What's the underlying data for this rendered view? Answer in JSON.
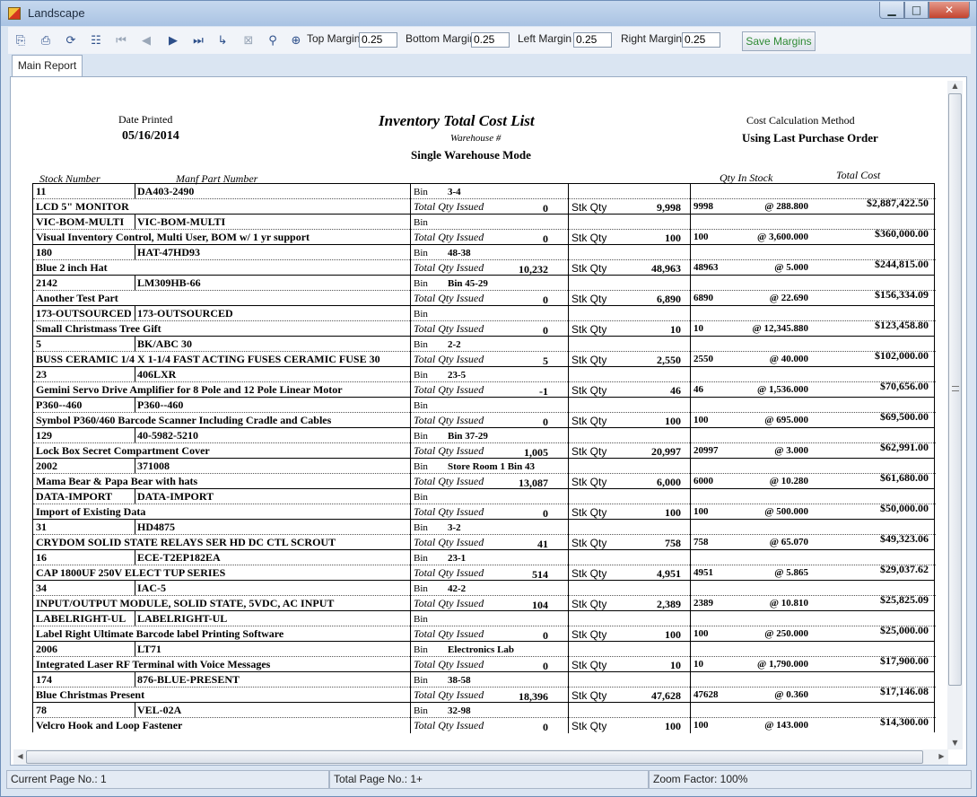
{
  "window": {
    "title": "Landscape"
  },
  "toolbar": {
    "icons": [
      "export-icon",
      "print-icon",
      "refresh-icon",
      "tree-icon",
      "first-page-icon",
      "prev-page-icon",
      "next-page-icon",
      "last-page-icon",
      "goto-page-icon",
      "stop-icon",
      "find-icon",
      "zoom-icon"
    ],
    "top_margin_label": "Top Margin",
    "top_margin": "0.25",
    "bottom_margin_label": "Bottom Margin",
    "bottom_margin": "0.25",
    "left_margin_label": "Left Margin",
    "left_margin": "0.25",
    "right_margin_label": "Right Margin",
    "right_margin": "0.25",
    "save_label": "Save Margins"
  },
  "tab": {
    "label": "Main Report"
  },
  "report": {
    "date_label": "Date Printed",
    "date": "05/16/2014",
    "title": "Inventory Total Cost List",
    "warehouse_label": "Warehouse #",
    "mode": "Single Warehouse Mode",
    "calc_label": "Cost Calculation Method",
    "calc_value": "Using Last Purchase Order",
    "col_stock": "Stock Number",
    "col_manf": "Manf Part Number",
    "col_qty": "Qty In Stock",
    "col_cost": "Total Cost",
    "bin_label": "Bin",
    "issued_label": "Total Qty Issued",
    "stk_label": "Stk Qty",
    "rows": [
      {
        "stock": "11",
        "manf": "DA403-2490",
        "bin": "3-4",
        "desc": "LCD 5\" MONITOR",
        "issued": "0",
        "stk": "9,998",
        "qty": "9998",
        "price": "@ 288.800",
        "total": "$2,887,422.50"
      },
      {
        "stock": "VIC-BOM-MULTI",
        "manf": "VIC-BOM-MULTI",
        "bin": "",
        "desc": "Visual Inventory Control, Multi User, BOM w/ 1 yr support",
        "issued": "0",
        "stk": "100",
        "qty": "100",
        "price": "@ 3,600.000",
        "total": "$360,000.00"
      },
      {
        "stock": "180",
        "manf": "HAT-47HD93",
        "bin": "48-38",
        "desc": "Blue 2 inch Hat",
        "issued": "10,232",
        "stk": "48,963",
        "qty": "48963",
        "price": "@ 5.000",
        "total": "$244,815.00"
      },
      {
        "stock": "2142",
        "manf": "LM309HB-66",
        "bin": "Bin 45-29",
        "desc": "Another Test Part",
        "issued": "0",
        "stk": "6,890",
        "qty": "6890",
        "price": "@ 22.690",
        "total": "$156,334.09"
      },
      {
        "stock": "173-OUTSOURCED",
        "manf": "173-OUTSOURCED",
        "bin": "",
        "desc": "Small Christmass Tree Gift",
        "issued": "0",
        "stk": "10",
        "qty": "10",
        "price": "@ 12,345.880",
        "total": "$123,458.80"
      },
      {
        "stock": "5",
        "manf": "BK/ABC 30",
        "bin": "2-2",
        "desc": "BUSS CERAMIC 1/4 X 1-1/4 FAST ACTING FUSES CERAMIC FUSE 30",
        "issued": "5",
        "stk": "2,550",
        "qty": "2550",
        "price": "@ 40.000",
        "total": "$102,000.00"
      },
      {
        "stock": "23",
        "manf": "406LXR",
        "bin": "23-5",
        "desc": "Gemini Servo Drive Amplifier for 8 Pole and 12 Pole Linear Motor",
        "issued": "-1",
        "stk": "46",
        "qty": "46",
        "price": "@ 1,536.000",
        "total": "$70,656.00"
      },
      {
        "stock": "P360--460",
        "manf": "P360--460",
        "bin": "",
        "desc": "Symbol P360/460 Barcode Scanner Including Cradle and Cables",
        "issued": "0",
        "stk": "100",
        "qty": "100",
        "price": "@ 695.000",
        "total": "$69,500.00"
      },
      {
        "stock": "129",
        "manf": "40-5982-5210",
        "bin": "Bin 37-29",
        "desc": "Lock Box Secret Compartment Cover",
        "issued": "1,005",
        "stk": "20,997",
        "qty": "20997",
        "price": "@ 3.000",
        "total": "$62,991.00"
      },
      {
        "stock": "2002",
        "manf": "371008",
        "bin": "Store Room 1 Bin 43",
        "desc": "Mama Bear & Papa Bear with hats",
        "issued": "13,087",
        "stk": "6,000",
        "qty": "6000",
        "price": "@ 10.280",
        "total": "$61,680.00"
      },
      {
        "stock": "DATA-IMPORT",
        "manf": "DATA-IMPORT",
        "bin": "",
        "desc": "Import of Existing Data",
        "issued": "0",
        "stk": "100",
        "qty": "100",
        "price": "@ 500.000",
        "total": "$50,000.00"
      },
      {
        "stock": "31",
        "manf": "HD4875",
        "bin": "3-2",
        "desc": "CRYDOM SOLID STATE RELAYS SER HD DC CTL SCROUT",
        "issued": "41",
        "stk": "758",
        "qty": "758",
        "price": "@ 65.070",
        "total": "$49,323.06"
      },
      {
        "stock": "16",
        "manf": "ECE-T2EP182EA",
        "bin": "23-1",
        "desc": "CAP 1800UF 250V ELECT TUP SERIES",
        "issued": "514",
        "stk": "4,951",
        "qty": "4951",
        "price": "@ 5.865",
        "total": "$29,037.62"
      },
      {
        "stock": "34",
        "manf": "IAC-5",
        "bin": "42-2",
        "desc": "INPUT/OUTPUT MODULE, SOLID STATE, 5VDC, AC INPUT",
        "issued": "104",
        "stk": "2,389",
        "qty": "2389",
        "price": "@ 10.810",
        "total": "$25,825.09"
      },
      {
        "stock": "LABELRIGHT-UL",
        "manf": "LABELRIGHT-UL",
        "bin": "",
        "desc": "Label Right Ultimate Barcode label Printing Software",
        "issued": "0",
        "stk": "100",
        "qty": "100",
        "price": "@ 250.000",
        "total": "$25,000.00"
      },
      {
        "stock": "2006",
        "manf": "LT71",
        "bin": "Electronics Lab",
        "desc": "Integrated Laser RF Terminal with Voice Messages",
        "issued": "0",
        "stk": "10",
        "qty": "10",
        "price": "@ 1,790.000",
        "total": "$17,900.00"
      },
      {
        "stock": "174",
        "manf": "876-BLUE-PRESENT",
        "bin": "38-58",
        "desc": "Blue Christmas Present",
        "issued": "18,396",
        "stk": "47,628",
        "qty": "47628",
        "price": "@ 0.360",
        "total": "$17,146.08"
      },
      {
        "stock": "78",
        "manf": "VEL-02A",
        "bin": "32-98",
        "desc": "Velcro Hook and Loop Fastener",
        "issued": "0",
        "stk": "100",
        "qty": "100",
        "price": "@ 143.000",
        "total": "$14,300.00"
      }
    ]
  },
  "status": {
    "current_page": "Current Page No.: 1",
    "total_page": "Total Page No.: 1+",
    "zoom": "Zoom Factor: 100%"
  }
}
